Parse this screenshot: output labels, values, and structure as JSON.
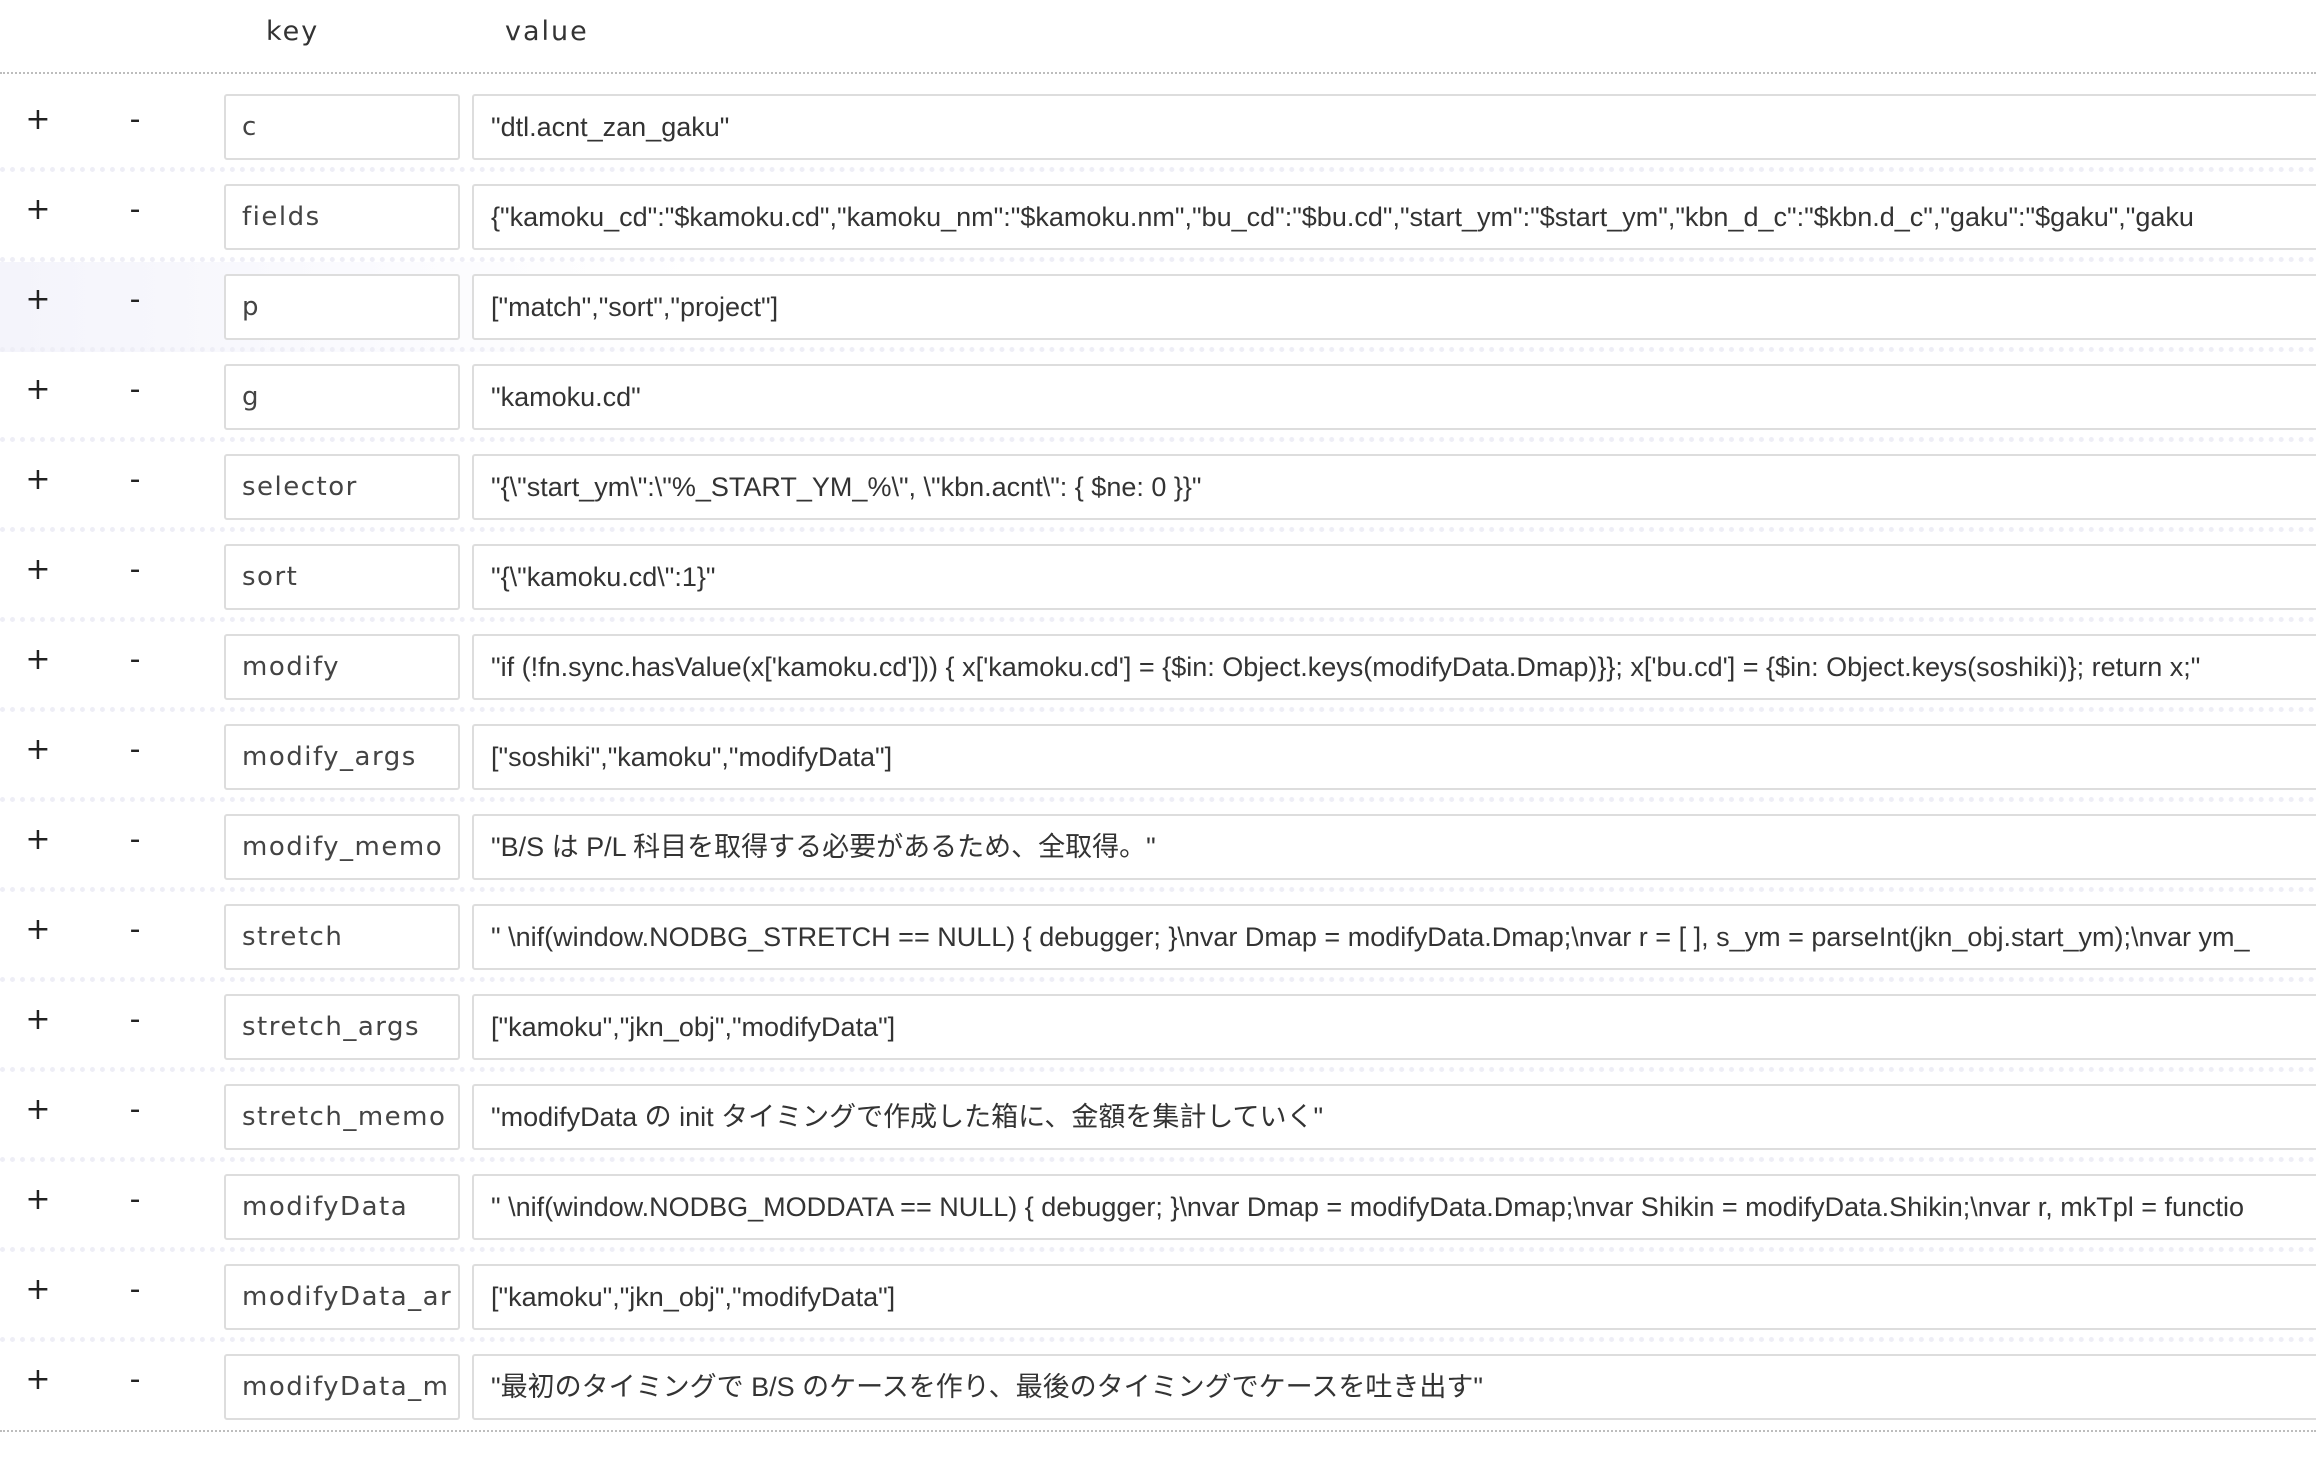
{
  "header": {
    "key_label": "key",
    "value_label": "value"
  },
  "controls": {
    "add_label": "+",
    "remove_label": "-"
  },
  "rows": [
    {
      "key": "c",
      "value": "\"dtl.acnt_zan_gaku\""
    },
    {
      "key": "fields",
      "value": "{\"kamoku_cd\":\"$kamoku.cd\",\"kamoku_nm\":\"$kamoku.nm\",\"bu_cd\":\"$bu.cd\",\"start_ym\":\"$start_ym\",\"kbn_d_c\":\"$kbn.d_c\",\"gaku\":\"$gaku\",\"gaku"
    },
    {
      "key": "p",
      "value": "[\"match\",\"sort\",\"project\"]"
    },
    {
      "key": "g",
      "value": "\"kamoku.cd\""
    },
    {
      "key": "selector",
      "value": "\"{\\\"start_ym\\\":\\\"%_START_YM_%\\\", \\\"kbn.acnt\\\": { $ne:  0 }}\""
    },
    {
      "key": "sort",
      "value": "\"{\\\"kamoku.cd\\\":1}\""
    },
    {
      "key": "modify",
      "value": "\"if (!fn.sync.hasValue(x['kamoku.cd'])) { x['kamoku.cd'] = {$in: Object.keys(modifyData.Dmap)}}; x['bu.cd'] = {$in: Object.keys(soshiki)}; return x;\""
    },
    {
      "key": "modify_args",
      "value": "[\"soshiki\",\"kamoku\",\"modifyData\"]"
    },
    {
      "key": "modify_memo",
      "value": "\"B/S は P/L 科目を取得する必要があるため、全取得。\""
    },
    {
      "key": "stretch",
      "value": "\" \\nif(window.NODBG_STRETCH == NULL) { debugger; }\\nvar Dmap = modifyData.Dmap;\\nvar r = [ ], s_ym = parseInt(jkn_obj.start_ym);\\nvar ym_"
    },
    {
      "key": "stretch_args",
      "value": "[\"kamoku\",\"jkn_obj\",\"modifyData\"]"
    },
    {
      "key": "stretch_memo",
      "value": "\"modifyData の init タイミングで作成した箱に、金額を集計していく\""
    },
    {
      "key": "modifyData",
      "value": "\" \\nif(window.NODBG_MODDATA == NULL) { debugger; }\\nvar Dmap = modifyData.Dmap;\\nvar Shikin = modifyData.Shikin;\\nvar r, mkTpl = functio"
    },
    {
      "key": "modifyData_ar",
      "value": "[\"kamoku\",\"jkn_obj\",\"modifyData\"]"
    },
    {
      "key": "modifyData_m",
      "value": "\"最初のタイミングで B/S のケースを作り、最後のタイミングでケースを吐き出す\""
    }
  ]
}
